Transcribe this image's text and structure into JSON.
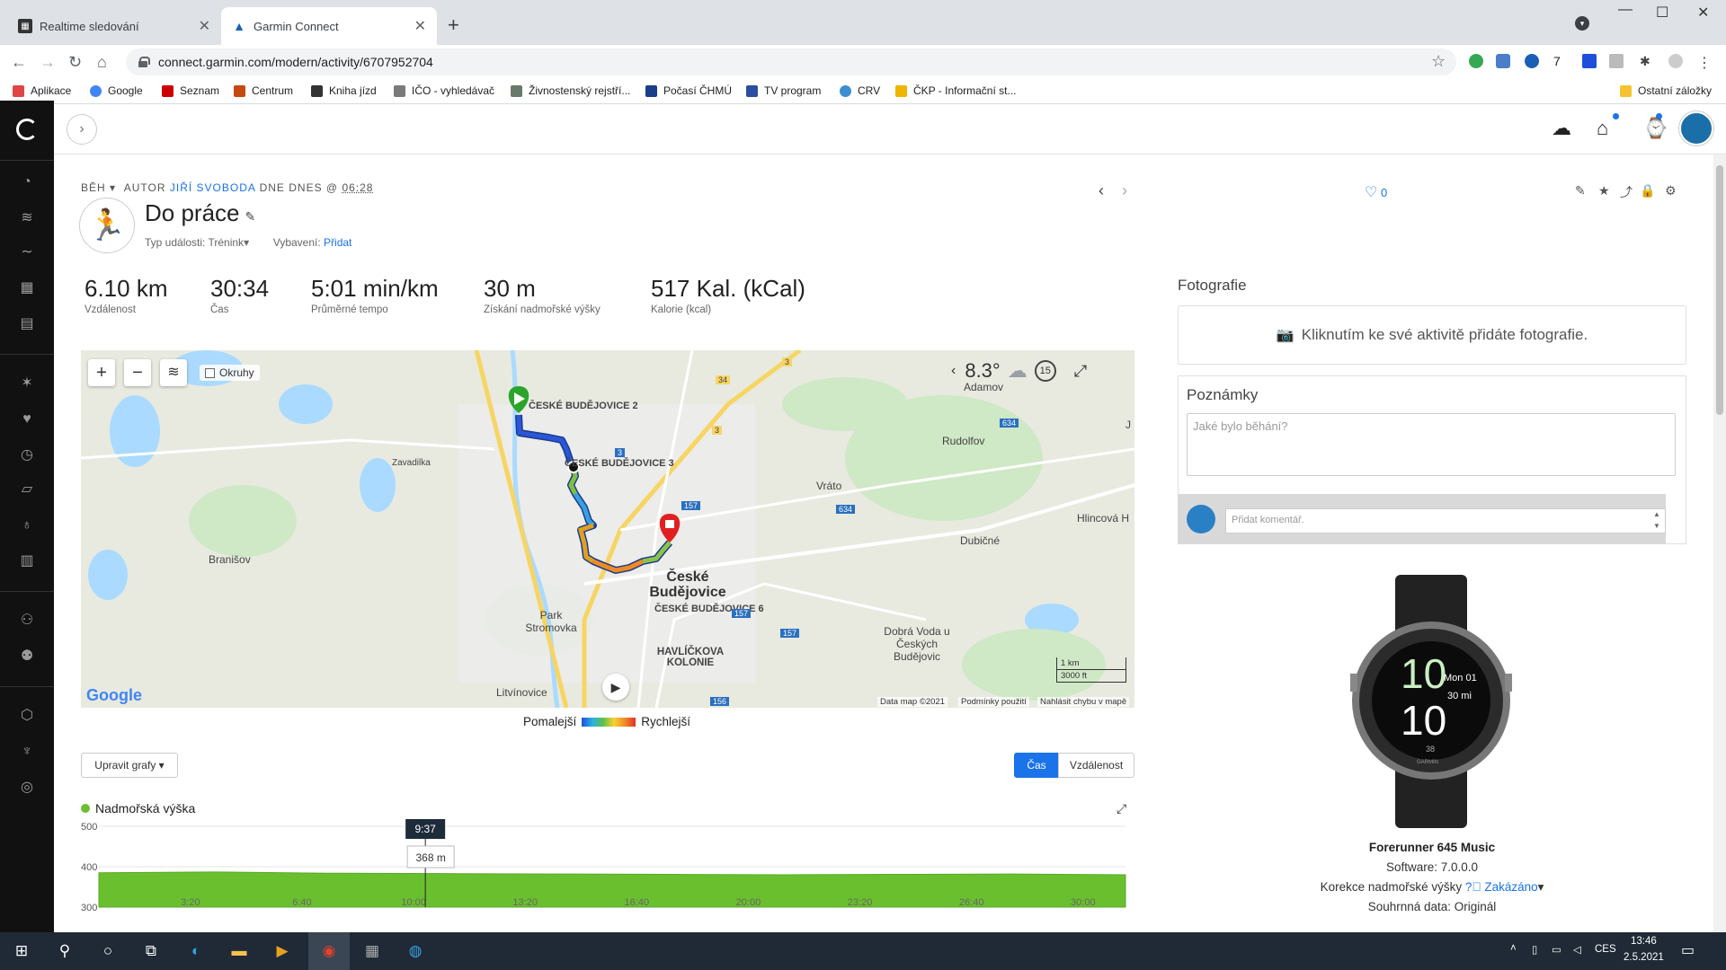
{
  "browser": {
    "tabs": [
      {
        "title": "Realtime sledování",
        "active": false
      },
      {
        "title": "Garmin Connect",
        "active": true
      }
    ],
    "url": "connect.garmin.com/modern/activity/6707952704",
    "bookmarks": [
      "Aplikace",
      "Google",
      "Seznam",
      "Centrum",
      "Kniha jízd",
      "IČO - vyhledávač",
      "Živnostenský rejstří...",
      "Počasí ČHMÚ",
      "TV program",
      "CRV",
      "ČKP - Informační st..."
    ],
    "other_bookmarks": "Ostatní záložky",
    "extension_badge": "7"
  },
  "activity": {
    "type_label": "BĚH",
    "author_prefix": "AUTOR",
    "author_name": "JIŘÍ SVOBODA",
    "date_label": "DNE DNES @",
    "time": "06:28",
    "title": "Do práce",
    "event_type_label": "Typ události: Trénink",
    "gear_label": "Vybavení:",
    "gear_link": "Přidat",
    "likes": "0"
  },
  "stats": [
    {
      "value": "6.10 km",
      "label": "Vzdálenost"
    },
    {
      "value": "30:34",
      "label": "Čas"
    },
    {
      "value": "5:01 min/km",
      "label": "Průměrné tempo"
    },
    {
      "value": "30 m",
      "label": "Získání nadmořské výšky"
    },
    {
      "value": "517 Kal. (kCal)",
      "label": "Kalorie (kcal)"
    }
  ],
  "map": {
    "okruhy_label": "Okruhy",
    "temperature": "8.3°",
    "timer_badge": "15",
    "labels": [
      "Adamov",
      "Rudolfov",
      "Vráto",
      "Hlincová H",
      "Dubičné",
      "Branišov",
      "Litvínovice",
      "Park Stromovka",
      "HAVLÍČKOVA KOLONIE",
      "Dobrá Voda u Českých Budějovic",
      "Zavadilka"
    ],
    "city": "České Budějovice",
    "city_small_1": "ČESKÉ BUDĚJOVICE 2",
    "city_small_2": "ČESKÉ BUDĚJOVICE 3",
    "city_small_3": "ČESKÉ BUDĚJOVICE 6",
    "road_numbers": [
      "3",
      "34",
      "3",
      "634",
      "157",
      "634",
      "157",
      "157",
      "3",
      "156",
      "J"
    ],
    "scale_km": "1 km",
    "scale_ft": "3000 ft",
    "footer_data": "Data map ©2021",
    "footer_terms": "Podmínky použití",
    "footer_report": "Nahlásit chybu v mapě",
    "google_logo": "Google"
  },
  "legend": {
    "slower": "Pomalejší",
    "faster": "Rychlejší"
  },
  "controls": {
    "edit_graphs": "Upravit grafy",
    "seg_time": "Čas",
    "seg_distance": "Vzdálenost"
  },
  "chart_data": {
    "type": "area",
    "title": "Nadmořská výška",
    "x": [
      "3:20",
      "6:40",
      "10:00",
      "13:20",
      "16:40",
      "20:00",
      "23:20",
      "26:40",
      "30:00"
    ],
    "y_ticks": [
      500,
      400,
      300
    ],
    "ylim": [
      300,
      500
    ],
    "series": [
      {
        "name": "Nadmořská výška",
        "values": [
          385,
          387,
          384,
          383,
          382,
          381,
          380,
          381,
          382,
          380
        ]
      }
    ],
    "tooltip": {
      "time": "9:37",
      "value": "368 m"
    },
    "color": "#6abf2e"
  },
  "right": {
    "photos_header": "Fotografie",
    "photos_cta": "Kliknutím ke své aktivitě přidáte fotografie.",
    "notes_header": "Poznámky",
    "notes_placeholder": "Jaké bylo běhání?",
    "comment_placeholder": "Přidat komentář.",
    "watch": {
      "hour1": "10",
      "hour2": "10",
      "date": "Mon 01",
      "steps": "30 mi",
      "brand": "GARMIN",
      "small": "38"
    },
    "device_name": "Forerunner 645 Music",
    "software": "Software: 7.0.0.0",
    "elev_corr_label": "Korekce nadmořské výšky",
    "elev_corr_value": "Zakázáno",
    "summary": "Souhrnná data: Originál"
  },
  "taskbar": {
    "lang": "CES",
    "time": "13:46",
    "date": "2.5.2021"
  }
}
